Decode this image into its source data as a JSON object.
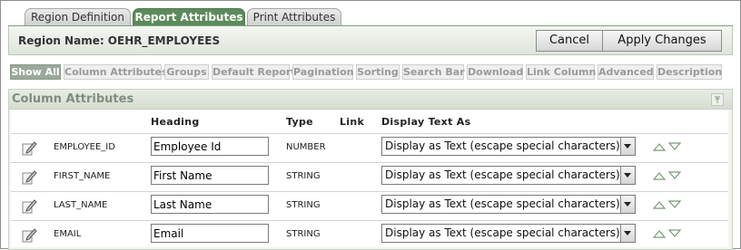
{
  "tabs": [
    {
      "label": "Region Definition",
      "active": false
    },
    {
      "label": "Report Attributes",
      "active": true
    },
    {
      "label": "Print Attributes",
      "active": false
    }
  ],
  "region": {
    "label": "Region Name: OEHR_EMPLOYEES"
  },
  "buttons": {
    "cancel": "Cancel",
    "apply": "Apply Changes"
  },
  "subnav": [
    "Show All",
    "Column Attributes",
    "Groups",
    "Default Report",
    "Pagination",
    "Sorting",
    "Search Bar",
    "Download",
    "Link Column",
    "Advanced",
    "Description"
  ],
  "section": {
    "title": "Column Attributes"
  },
  "table": {
    "headers": {
      "heading": "Heading",
      "type": "Type",
      "link": "Link",
      "display": "Display Text As"
    },
    "rows": [
      {
        "column": "EMPLOYEE_ID",
        "heading": "Employee Id",
        "type": "NUMBER",
        "display": "Display as Text (escape special characters)"
      },
      {
        "column": "FIRST_NAME",
        "heading": "First Name",
        "type": "STRING",
        "display": "Display as Text (escape special characters)"
      },
      {
        "column": "LAST_NAME",
        "heading": "Last Name",
        "type": "STRING",
        "display": "Display as Text (escape special characters)"
      },
      {
        "column": "EMAIL",
        "heading": "Email",
        "type": "STRING",
        "display": "Display as Text (escape special characters)"
      }
    ]
  },
  "colors": {
    "active_tab": "#5c8a5c",
    "active_subnav": "#9aa99a"
  }
}
